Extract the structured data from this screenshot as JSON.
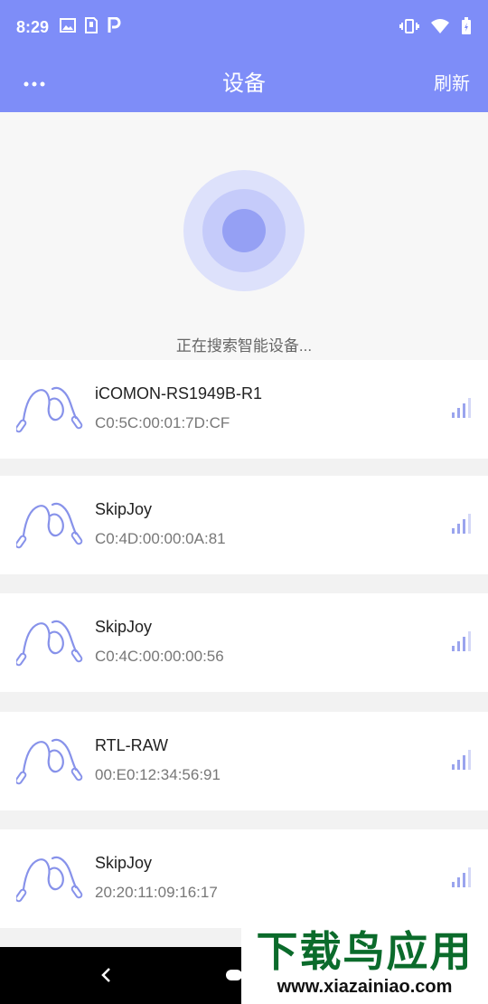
{
  "status_bar": {
    "time": "8:29"
  },
  "app_bar": {
    "title": "设备",
    "refresh_label": "刷新"
  },
  "search": {
    "status_text": "正在搜索智能设备..."
  },
  "devices": [
    {
      "name": "iCOMON-RS1949B-R1",
      "mac": "C0:5C:00:01:7D:CF",
      "signal_icon": "signal-bars-icon"
    },
    {
      "name": "SkipJoy",
      "mac": "C0:4D:00:00:0A:81",
      "signal_icon": "signal-bars-icon"
    },
    {
      "name": "SkipJoy",
      "mac": "C0:4C:00:00:00:56",
      "signal_icon": "signal-bars-icon"
    },
    {
      "name": "RTL-RAW",
      "mac": "00:E0:12:34:56:91",
      "signal_icon": "signal-bars-icon"
    },
    {
      "name": "SkipJoy",
      "mac": "20:20:11:09:16:17",
      "signal_icon": "signal-bars-icon"
    }
  ],
  "watermark": {
    "title": "下载鸟应用",
    "url": "www.xiazainiao.com"
  },
  "colors": {
    "primary": "#7e8df8",
    "pulse_outer": "#dde1fb",
    "pulse_mid": "#c5cbfa",
    "pulse_inner": "#95a0f4",
    "signal": "#9aa4ee"
  }
}
